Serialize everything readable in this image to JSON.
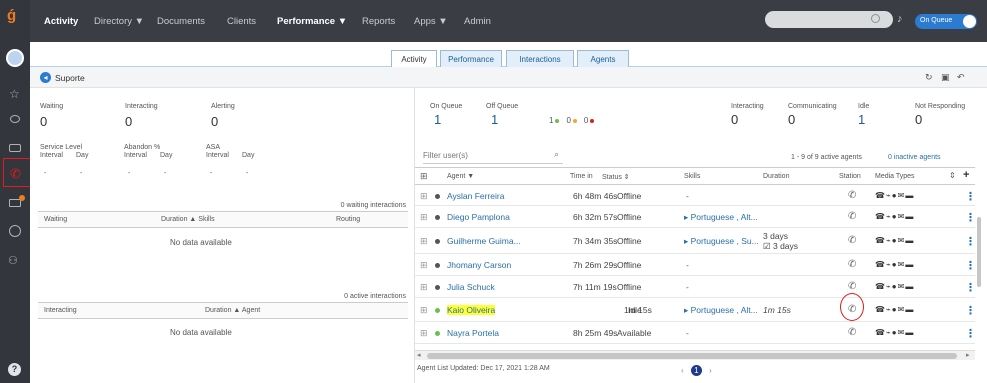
{
  "nav": {
    "items": [
      "Activity",
      "Directory ▼",
      "Documents",
      "Clients",
      "Performance ▼",
      "Reports",
      "Apps ▼",
      "Admin"
    ],
    "status": "On Queue"
  },
  "tabs": [
    "Activity",
    "Performance",
    "Interactions",
    "Agents"
  ],
  "queue": {
    "name": "Suporte",
    "stats": [
      {
        "label": "Waiting",
        "value": "0"
      },
      {
        "label": "Interacting",
        "value": "0"
      },
      {
        "label": "Alerting",
        "value": "0"
      }
    ],
    "sla": [
      {
        "label": "Service Level",
        "sub": [
          "Interval",
          "Day"
        ],
        "vals": [
          "-",
          "-"
        ]
      },
      {
        "label": "Abandon %",
        "sub": [
          "Interval",
          "Day"
        ],
        "vals": [
          "-",
          "-"
        ]
      },
      {
        "label": "ASA",
        "sub": [
          "Interval",
          "Day"
        ],
        "vals": [
          "-",
          "-"
        ]
      }
    ],
    "waiting": {
      "count_label": "0 waiting interactions",
      "cols": [
        "Waiting",
        "Duration ▲ Skills",
        "Routing"
      ],
      "empty": "No data available"
    },
    "interacting": {
      "count_label": "0 active interactions",
      "cols": [
        "Interacting",
        "Duration ▲ Agent"
      ],
      "empty": "No data available"
    }
  },
  "agents": {
    "summary": [
      {
        "label": "On Queue",
        "value": "1"
      },
      {
        "label": "Off Queue",
        "value": "1"
      },
      {
        "label": "Interacting",
        "value": "0"
      },
      {
        "label": "Communicating",
        "value": "0"
      },
      {
        "label": "Idle",
        "value": "1"
      },
      {
        "label": "Not Responding",
        "value": "0"
      }
    ],
    "offqueue_breakdown": [
      "1",
      "0",
      "0"
    ],
    "filter_placeholder": "Filter user(s)",
    "count_text": "1 - 9 of 9 active agents",
    "inactive_text": "0 inactive agents",
    "columns": [
      "Agent ▼",
      "Time in",
      "Status ⇕",
      "Skills",
      "Duration",
      "Station",
      "Media Types"
    ],
    "rows": [
      {
        "name": "Ayslan Ferreira",
        "time": "6h 48m 46s",
        "status": "Offline",
        "skills": "-",
        "duration": "",
        "highlight": false,
        "dot": "#555"
      },
      {
        "name": "Diego Pamplona",
        "time": "6h 32m 57s",
        "status": "Offline",
        "skills": "▸ Portuguese , Alt...",
        "duration": "",
        "highlight": false,
        "dot": "#555"
      },
      {
        "name": "Guilherme Guima...",
        "time": "7h 34m 35s",
        "status": "Offline",
        "skills": "▸ Portuguese , Su...",
        "duration": "3 days",
        "duration2": "☑ 3 days",
        "highlight": false,
        "dot": "#555"
      },
      {
        "name": "Jhomany Carson",
        "time": "7h 26m 29s",
        "status": "Offline",
        "skills": "-",
        "duration": "",
        "highlight": false,
        "dot": "#555"
      },
      {
        "name": "Julia Schuck",
        "time": "7h 11m 19s",
        "status": "Offline",
        "skills": "-",
        "duration": "",
        "highlight": false,
        "dot": "#555"
      },
      {
        "name": "Kaio Oliveira",
        "time": "1m 15s",
        "status": "Idle",
        "skills": "▸ Portuguese , Alt...",
        "duration": "1m 15s",
        "highlight": true,
        "dot": "#6cc04a"
      },
      {
        "name": "Nayra Portela",
        "time": "8h 25m 49s",
        "status": "Available",
        "skills": "-",
        "duration": "",
        "highlight": false,
        "dot": "#6cc04a"
      }
    ],
    "footer": "Agent List Updated: Dec 17, 2021 1:28 AM",
    "page": "1"
  },
  "colors": {
    "accent": "#1b5f97",
    "nav": "#3a3d44",
    "rail": "#33363d",
    "highlight": "#ffff33",
    "annotation": "#e31b1b"
  }
}
